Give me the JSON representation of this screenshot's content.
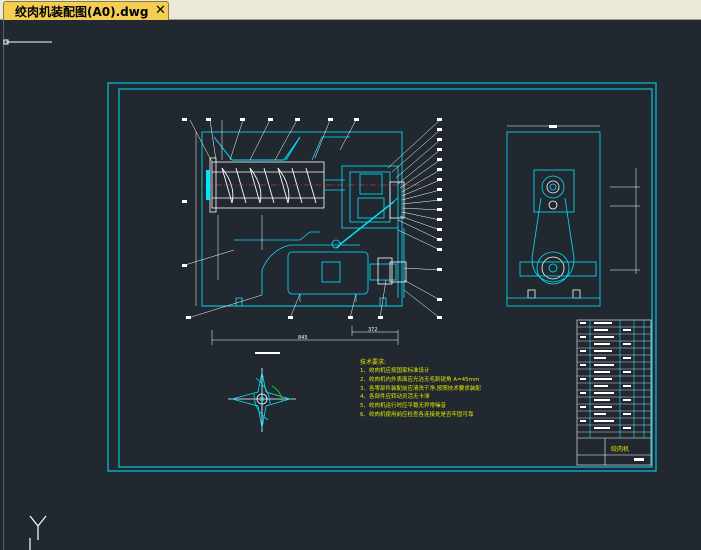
{
  "tab": {
    "title": "绞肉机装配图(A0).dwg",
    "close_symbol": "✕"
  },
  "drawing": {
    "dimension_total": "845",
    "dimension_lower": "372",
    "notes_title": "技术要求:",
    "notes": [
      "1、绞肉机应按国家标准设计",
      "2、绞肉机内外表面应光洁无毛刺锐角 A=45mm",
      "3、各零部件装配前应清洗干净,按照技术要求装配",
      "4、各部件应转动灵活无卡滞",
      "5、绞肉机运行时应平稳无异常噪音",
      "6、绞肉机使用前应检查各连接处是否牢固可靠"
    ],
    "title_block_name": "绞肉机"
  },
  "colors": {
    "background": "#212830",
    "line": "#00e5ff",
    "white": "#ffffff",
    "yellow": "#e6e600",
    "green": "#22dd22",
    "tab": "#f4ce54"
  }
}
